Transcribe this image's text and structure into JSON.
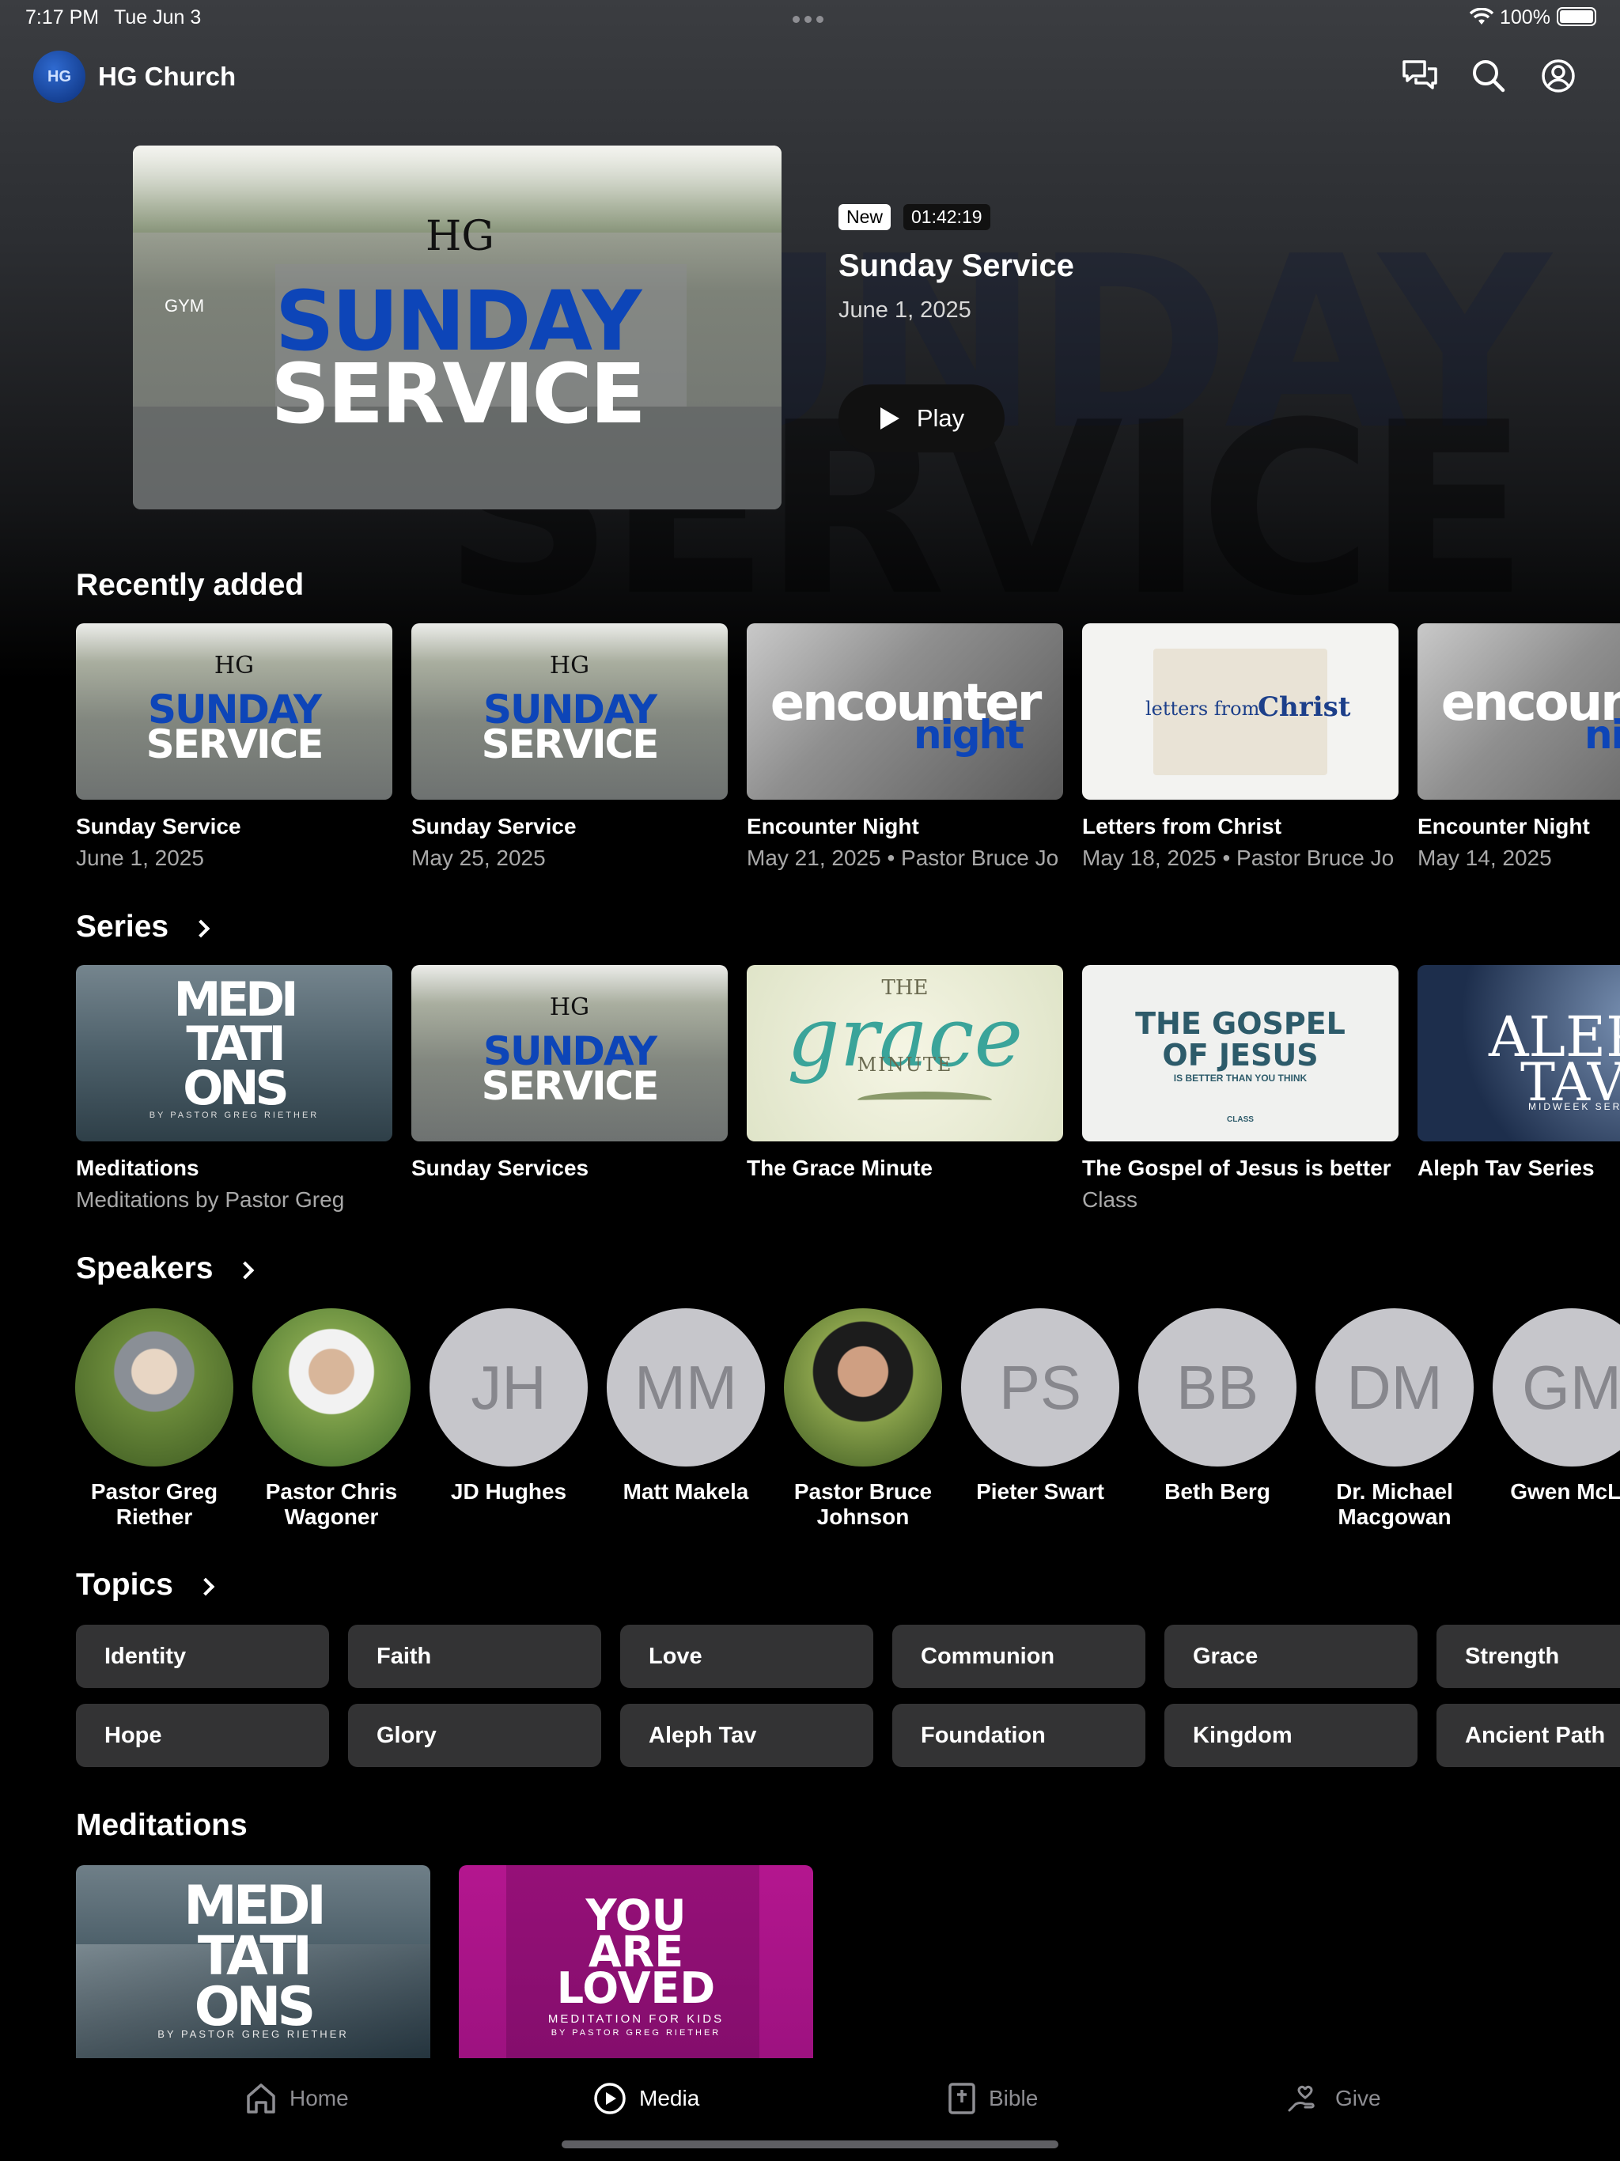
{
  "status_bar": {
    "time": "7:17 PM",
    "date": "Tue Jun 3",
    "battery": "100%"
  },
  "header": {
    "app_name": "HG Church",
    "logo_text": "HG"
  },
  "hero": {
    "badge_new": "New",
    "duration": "01:42:19",
    "title": "Sunday Service",
    "date": "June 1, 2025",
    "play_label": "Play",
    "artwork": {
      "logo": "HG",
      "line1": "SUNDAY",
      "line2": "SERVICE",
      "sign": "GYM"
    }
  },
  "recently_added": {
    "title": "Recently added",
    "items": [
      {
        "title": "Sunday Service",
        "subtitle": "June 1, 2025",
        "art": "sunday"
      },
      {
        "title": "Sunday Service",
        "subtitle": "May 25, 2025",
        "art": "sunday"
      },
      {
        "title": "Encounter Night",
        "subtitle": "May 21, 2025 • Pastor Bruce Jo",
        "art": "encounter"
      },
      {
        "title": "Letters from Christ",
        "subtitle": "May 18, 2025 • Pastor Bruce Jo",
        "art": "letters"
      },
      {
        "title": "Encounter Night",
        "subtitle": "May 14, 2025",
        "art": "encounter"
      }
    ],
    "art_text": {
      "encounter1": "encounter",
      "encounter2": "night",
      "letters1": "letters from",
      "letters2": "Christ"
    }
  },
  "series": {
    "title": "Series",
    "items": [
      {
        "title": "Meditations",
        "subtitle": "Meditations by Pastor Greg",
        "art": "meditations"
      },
      {
        "title": "Sunday Services",
        "subtitle": "",
        "art": "sunday"
      },
      {
        "title": "The Grace Minute",
        "subtitle": "",
        "art": "grace"
      },
      {
        "title": "The Gospel of Jesus is better",
        "subtitle": "Class",
        "art": "gospel"
      },
      {
        "title": "Aleph Tav Series",
        "subtitle": "",
        "art": "aleph"
      }
    ],
    "art_text": {
      "med1": "MEDI",
      "med2": "TATI",
      "med3": "ONS",
      "med_by": "BY PASTOR GREG RIETHER",
      "grace_the": "THE",
      "grace": "grace",
      "grace_min": "MINUTE",
      "gospel1": "THE GOSPEL",
      "gospel2": "OF JESUS",
      "gospel3": "IS BETTER THAN YOU THINK",
      "gospel4": "CLASS",
      "aleph1": "ALEPH",
      "aleph2": "TAV",
      "aleph3": "MIDWEEK SERIES"
    }
  },
  "speakers": {
    "title": "Speakers",
    "items": [
      {
        "name": "Pastor Greg Riether",
        "initials": "",
        "photo": true
      },
      {
        "name": "Pastor Chris Wagoner",
        "initials": "",
        "photo": true
      },
      {
        "name": "JD Hughes",
        "initials": "JH",
        "photo": false
      },
      {
        "name": "Matt Makela",
        "initials": "MM",
        "photo": false
      },
      {
        "name": "Pastor Bruce Johnson",
        "initials": "",
        "photo": true
      },
      {
        "name": "Pieter Swart",
        "initials": "PS",
        "photo": false
      },
      {
        "name": "Beth Berg",
        "initials": "BB",
        "photo": false
      },
      {
        "name": "Dr. Michael Macgowan",
        "initials": "DM",
        "photo": false
      },
      {
        "name": "Gwen McLe",
        "initials": "GM",
        "photo": false
      }
    ]
  },
  "topics": {
    "title": "Topics",
    "row1": [
      "Identity",
      "Faith",
      "Love",
      "Communion",
      "Grace",
      "Strength"
    ],
    "row2": [
      "Hope",
      "Glory",
      "Aleph Tav",
      "Foundation",
      "Kingdom",
      "Ancient Path"
    ]
  },
  "meditations": {
    "title": "Meditations",
    "art_text": {
      "loved1": "YOU",
      "loved2": "ARE",
      "loved3": "LOVED",
      "loved4": "MEDITATION FOR KIDS",
      "loved5": "BY PASTOR GREG RIETHER"
    }
  },
  "tab_bar": {
    "home": "Home",
    "media": "Media",
    "bible": "Bible",
    "give": "Give",
    "active": "media"
  },
  "icons": {
    "header": [
      "chat-icon",
      "search-icon",
      "account-icon"
    ],
    "tabs": [
      "home-icon",
      "play-circle-icon",
      "bible-icon",
      "give-icon"
    ]
  },
  "colors": {
    "background": "#000000",
    "chip": "#333334",
    "brand_blue": "#0d45b8",
    "placeholder_avatar": "#c6c6cb",
    "inactive_tab": "#8e8e93"
  }
}
